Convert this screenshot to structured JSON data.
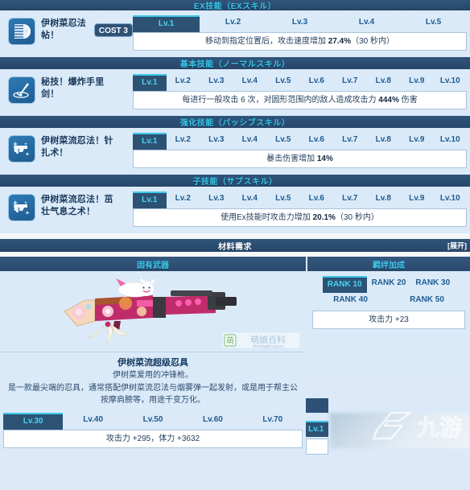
{
  "sections": [
    {
      "header": "EX技能（EXスキル）",
      "skill": {
        "icon": "scroll-icon",
        "name": "伊树菜忍法帖！",
        "cost": "COST 3",
        "levels": [
          "Lv.1",
          "Lv.2",
          "Lv.3",
          "Lv.4",
          "Lv.5"
        ],
        "active_level": 0,
        "description_pre": "移动到指定位置后，攻击速度增加 ",
        "description_val": "27.4%",
        "description_post": "（30 秒内）"
      }
    },
    {
      "header": "基本技能（ノーマルスキル）",
      "skill": {
        "icon": "shuriken-icon",
        "name": "秘技！爆炸手里剑！",
        "cost": "",
        "levels": [
          "Lv.1",
          "Lv.2",
          "Lv.3",
          "Lv.4",
          "Lv.5",
          "Lv.6",
          "Lv.7",
          "Lv.8",
          "Lv.9",
          "Lv.10"
        ],
        "active_level": 0,
        "description_pre": "每进行一般攻击 6 次，对圆形范围内的敌人造成攻击力 ",
        "description_val": "444%",
        "description_post": " 伤害"
      }
    },
    {
      "header": "强化技能（パッシブスキル）",
      "skill": {
        "icon": "gun-sparkle-icon",
        "name": "伊树菜流忍法！针扎术！",
        "cost": "",
        "levels": [
          "Lv.1",
          "Lv.2",
          "Lv.3",
          "Lv.4",
          "Lv.5",
          "Lv.6",
          "Lv.7",
          "Lv.8",
          "Lv.9",
          "Lv.10"
        ],
        "active_level": 0,
        "description_pre": "暴击伤害增加 ",
        "description_val": "14%",
        "description_post": ""
      }
    },
    {
      "header": "子技能（サブスキル）",
      "skill": {
        "icon": "gun-sparkle-icon",
        "name": "伊树菜流忍法！茁壮气息之术！",
        "cost": "",
        "levels": [
          "Lv.1",
          "Lv.2",
          "Lv.3",
          "Lv.4",
          "Lv.5",
          "Lv.6",
          "Lv.7",
          "Lv.8",
          "Lv.9",
          "Lv.10"
        ],
        "active_level": 0,
        "description_pre": "使用Ex技能时攻击力增加 ",
        "description_val": "20.1%",
        "description_post": "（30 秒内）"
      }
    }
  ],
  "material": {
    "title": "材料需求",
    "expand": "[展开]"
  },
  "weapon": {
    "column_title": "固有武器",
    "name": "伊树菜流超级忍具",
    "subtitle": "伊树菜爱用的冲锋枪。",
    "description": "是一款最尖端的忍具，通常搭配伊树菜流忍法与烟雾弹一起发射，或是用于帮主公按摩肩膀等，用途千变万化。",
    "levels": [
      "Lv.30",
      "Lv.40",
      "Lv.50",
      "Lv.60",
      "Lv.70"
    ],
    "active_level": 0,
    "stat_line": "攻击力 +295，体力 +3632",
    "watermark": "萌娘百科 zh.moegirl.org.cn"
  },
  "bond": {
    "column_title": "羁绊加成",
    "ranks": [
      "RANK 10",
      "RANK 20",
      "RANK 30",
      "RANK 40",
      "RANK 50"
    ],
    "active_rank": 0,
    "stat_line": "攻击力 +23",
    "side_level": "Lv.1",
    "watermark": "九游"
  },
  "colors": {
    "panel_bg": "#dbeaf9",
    "header_bar": "#2d5274",
    "accent_cyan": "#3fc9ea",
    "tab_text": "#1f5c90",
    "body_text": "#24405e"
  }
}
